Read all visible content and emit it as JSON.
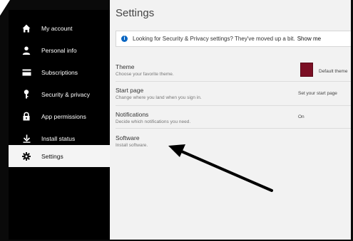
{
  "sidebar": {
    "items": [
      {
        "label": "My account",
        "icon": "home-icon"
      },
      {
        "label": "Personal info",
        "icon": "person-icon"
      },
      {
        "label": "Subscriptions",
        "icon": "card-icon"
      },
      {
        "label": "Security & privacy",
        "icon": "key-icon"
      },
      {
        "label": "App permissions",
        "icon": "lock-icon"
      },
      {
        "label": "Install status",
        "icon": "download-icon"
      },
      {
        "label": "Settings",
        "icon": "gear-icon",
        "active": true
      }
    ]
  },
  "main": {
    "title": "Settings",
    "banner": {
      "text": "Looking for Security & Privacy settings? They've moved up a bit.",
      "link": "Show me"
    },
    "settings": [
      {
        "title": "Theme",
        "desc": "Choose your favorite theme.",
        "value": "Default theme"
      },
      {
        "title": "Start page",
        "desc": "Change where you land when you sign in.",
        "value": "Set your start page"
      },
      {
        "title": "Notifications",
        "desc": "Decide which notifications you need.",
        "value": "On"
      },
      {
        "title": "Software",
        "desc": "Install software."
      }
    ]
  },
  "colors": {
    "sidebar_bg": "#000000",
    "theme_swatch": "#7b0f24",
    "info_icon": "#0a66c2",
    "content_bg": "#f2f2f2"
  }
}
